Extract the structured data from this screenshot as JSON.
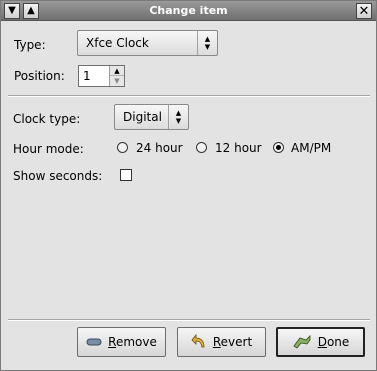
{
  "window": {
    "title": "Change item",
    "menu_glyph": "▼",
    "shade_glyph": "▲",
    "close_glyph": "✕"
  },
  "type": {
    "label": "Type:",
    "value": "Xfce Clock"
  },
  "position": {
    "label": "Position:",
    "value": "1"
  },
  "clock_type": {
    "label": "Clock type:",
    "value": "Digital"
  },
  "hour_mode": {
    "label": "Hour mode:",
    "options": [
      "24 hour",
      "12 hour",
      "AM/PM"
    ],
    "selected": "AM/PM"
  },
  "show_seconds": {
    "label": "Show seconds:",
    "checked": false
  },
  "buttons": {
    "remove": {
      "first": "R",
      "rest": "emove",
      "icon": "remove-icon"
    },
    "revert": {
      "first": "R",
      "rest": "evert",
      "icon": "revert-icon"
    },
    "done": {
      "first": "D",
      "rest": "one",
      "icon": "done-icon"
    }
  },
  "colors": {
    "titlebar": "#7f7f7f",
    "window_bg": "#e3e3e3"
  }
}
